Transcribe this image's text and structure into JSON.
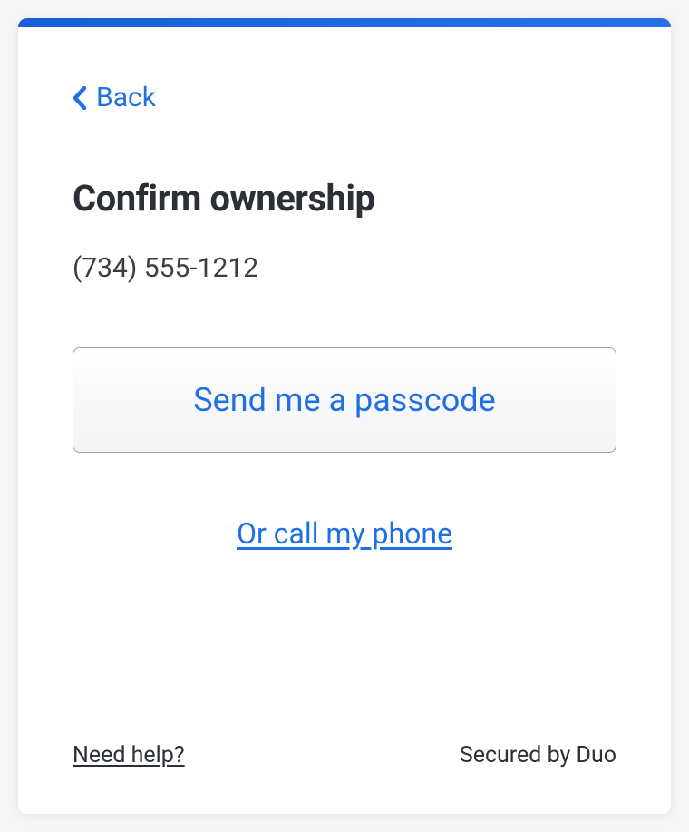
{
  "colors": {
    "accent": "#1f6fe5",
    "top_bar": "#1a5fd8",
    "text_dark": "#2b2f36"
  },
  "nav": {
    "back_label": "Back"
  },
  "main": {
    "heading": "Confirm ownership",
    "phone_number": "(734) 555-1212",
    "primary_button_label": "Send me a passcode",
    "secondary_link_label": "Or call my phone"
  },
  "footer": {
    "help_label": "Need help?",
    "secured_label": "Secured by Duo"
  }
}
